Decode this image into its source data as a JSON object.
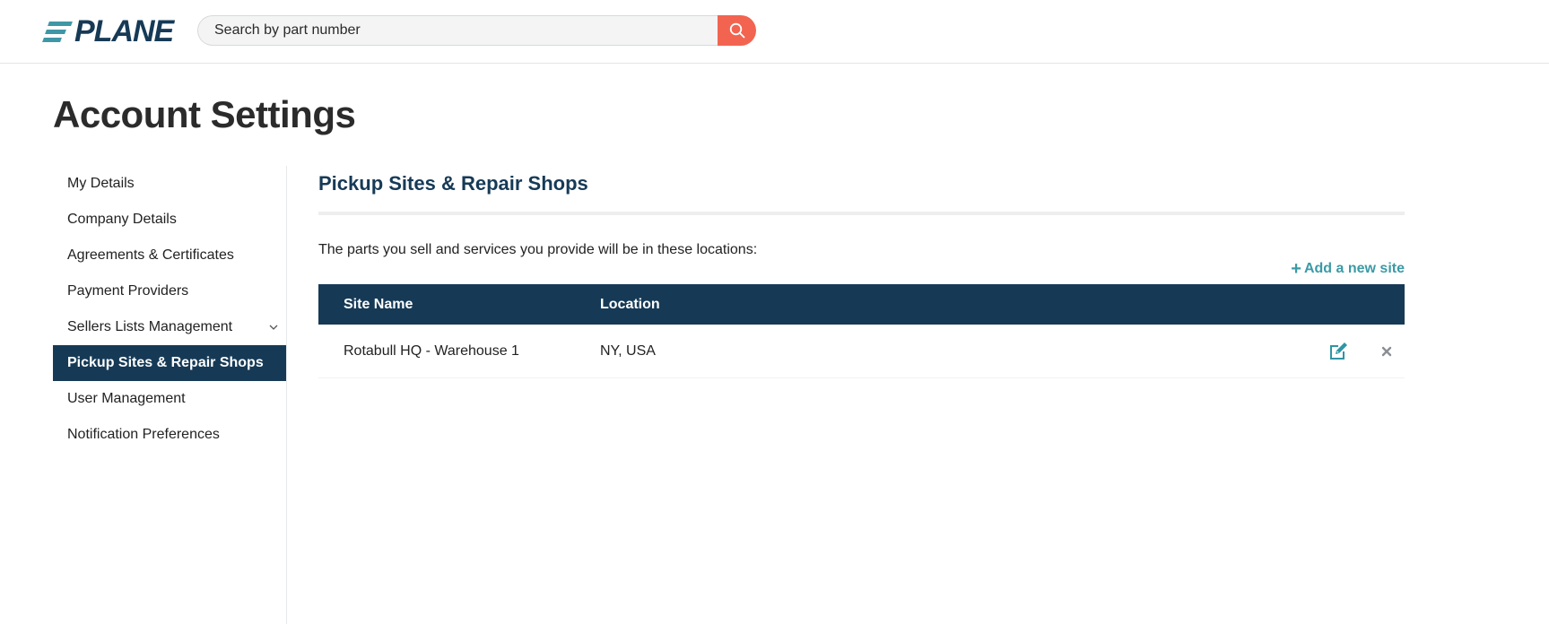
{
  "header": {
    "logo_text": "PLANE",
    "search_placeholder": "Search by part number",
    "search_button_icon": "search-icon",
    "colors": {
      "brand_navy": "#163a56",
      "brand_teal": "#3f97a6",
      "search_button": "#f26450"
    }
  },
  "page": {
    "title": "Account Settings"
  },
  "sidebar": {
    "items": [
      {
        "label": "My Details",
        "active": false
      },
      {
        "label": "Company Details",
        "active": false
      },
      {
        "label": "Agreements & Certificates",
        "active": false
      },
      {
        "label": "Payment Providers",
        "active": false
      },
      {
        "label": "Sellers Lists Management",
        "active": false,
        "icon": "chevron-down-icon"
      },
      {
        "label": "Pickup Sites & Repair Shops",
        "active": true
      },
      {
        "label": "User Management",
        "active": false
      },
      {
        "label": "Notification Preferences",
        "active": false
      }
    ]
  },
  "main": {
    "section_title": "Pickup Sites & Repair Shops",
    "description": "The parts you sell and services you provide will be in these locations:",
    "add_site_label": "Add a new site",
    "table": {
      "columns": [
        "Site Name",
        "Location"
      ],
      "rows": [
        {
          "site_name": "Rotabull HQ - Warehouse 1",
          "location": "NY, USA",
          "actions": [
            "edit-icon",
            "close-icon"
          ]
        }
      ]
    }
  }
}
